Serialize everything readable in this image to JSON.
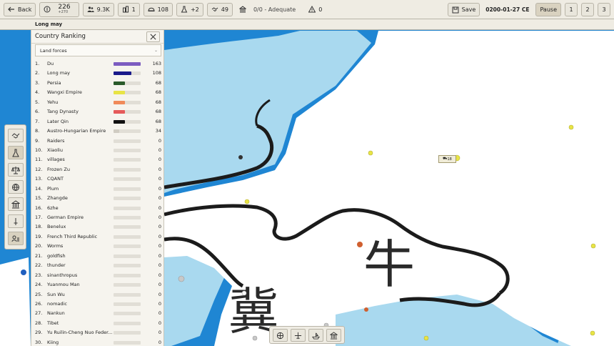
{
  "toolbar": {
    "back_label": "Back",
    "treasury": "226",
    "treasury_income": "+270",
    "manpower": "9.3K",
    "population": "1",
    "force_count": "108",
    "research": "+2",
    "diplomacy": "49",
    "supply": "0/0 - Adequate",
    "warnings": "0",
    "save_label": "Save",
    "date": "0200-01-27 CE",
    "pause_label": "Pause",
    "speed_buttons": [
      "1",
      "2",
      "3"
    ]
  },
  "subbar": {
    "country_name": "Long may"
  },
  "ranking_panel": {
    "title": "Country Ranking",
    "selected_metric": "Land forces",
    "max_value": 163,
    "rows": [
      {
        "rank": "1.",
        "name": "Du",
        "value": "163",
        "color": "#7c5cc0"
      },
      {
        "rank": "2.",
        "name": "Long may",
        "value": "108",
        "color": "#1a1a8a"
      },
      {
        "rank": "3.",
        "name": "Persia",
        "value": "68",
        "color": "#2a5a2a"
      },
      {
        "rank": "4.",
        "name": "Wangxi Empire",
        "value": "68",
        "color": "#e8e445"
      },
      {
        "rank": "5.",
        "name": "Yehu",
        "value": "68",
        "color": "#f08a5a"
      },
      {
        "rank": "6.",
        "name": "Tang Dynasty",
        "value": "68",
        "color": "#e55a5a"
      },
      {
        "rank": "7.",
        "name": "Later Qin",
        "value": "68",
        "color": "#111111"
      },
      {
        "rank": "8.",
        "name": "Austro-Hungarian Empire",
        "value": "34",
        "color": "#d0ccc2"
      },
      {
        "rank": "9.",
        "name": "Raiders",
        "value": "0",
        "color": "#d0ccc2"
      },
      {
        "rank": "10.",
        "name": "Xiaoliu",
        "value": "0",
        "color": "#d0ccc2"
      },
      {
        "rank": "11.",
        "name": "villages",
        "value": "0",
        "color": "#d0ccc2"
      },
      {
        "rank": "12.",
        "name": "Frozen Zu",
        "value": "0",
        "color": "#d0ccc2"
      },
      {
        "rank": "13.",
        "name": "CQANT",
        "value": "0",
        "color": "#d0ccc2"
      },
      {
        "rank": "14.",
        "name": "Plum",
        "value": "0",
        "color": "#d0ccc2"
      },
      {
        "rank": "15.",
        "name": "Zhangde",
        "value": "0",
        "color": "#d0ccc2"
      },
      {
        "rank": "16.",
        "name": "6zhe",
        "value": "0",
        "color": "#d0ccc2"
      },
      {
        "rank": "17.",
        "name": "German Empire",
        "value": "0",
        "color": "#d0ccc2"
      },
      {
        "rank": "18.",
        "name": "Benelux",
        "value": "0",
        "color": "#d0ccc2"
      },
      {
        "rank": "19.",
        "name": "French Third Republic",
        "value": "0",
        "color": "#d0ccc2"
      },
      {
        "rank": "20.",
        "name": "Worms",
        "value": "0",
        "color": "#d0ccc2"
      },
      {
        "rank": "21.",
        "name": "goldfish",
        "value": "0",
        "color": "#d0ccc2"
      },
      {
        "rank": "22.",
        "name": "thunder",
        "value": "0",
        "color": "#d0ccc2"
      },
      {
        "rank": "23.",
        "name": "sinanthropus",
        "value": "0",
        "color": "#d0ccc2"
      },
      {
        "rank": "24.",
        "name": "Yuanmou Man",
        "value": "0",
        "color": "#d0ccc2"
      },
      {
        "rank": "25.",
        "name": "Sun Wu",
        "value": "0",
        "color": "#d0ccc2"
      },
      {
        "rank": "26.",
        "name": "nomadic",
        "value": "0",
        "color": "#d0ccc2"
      },
      {
        "rank": "27.",
        "name": "Nankun",
        "value": "0",
        "color": "#d0ccc2"
      },
      {
        "rank": "28.",
        "name": "Tibet",
        "value": "0",
        "color": "#d0ccc2"
      },
      {
        "rank": "29.",
        "name": "Yu Ruilin-Cheng Nuo Feder...",
        "value": "0",
        "color": "#d0ccc2"
      },
      {
        "rank": "30.",
        "name": "Kiing",
        "value": "0",
        "color": "#d0ccc2"
      }
    ]
  },
  "map": {
    "labels": [
      "牛",
      "冀"
    ],
    "unit_tag": "18",
    "colors": {
      "water": "#1f86d3",
      "shallow": "#a9d9ef",
      "land": "#ffffff",
      "border": "#1b1b1b"
    }
  },
  "left_tools": [
    "diplomacy-icon",
    "flask-icon",
    "scales-icon",
    "globe-icon",
    "bank-icon",
    "sword-icon",
    "person-list-icon"
  ],
  "bottom_tools": [
    "globe-icon",
    "plane-icon",
    "ship-icon",
    "building-icon"
  ]
}
